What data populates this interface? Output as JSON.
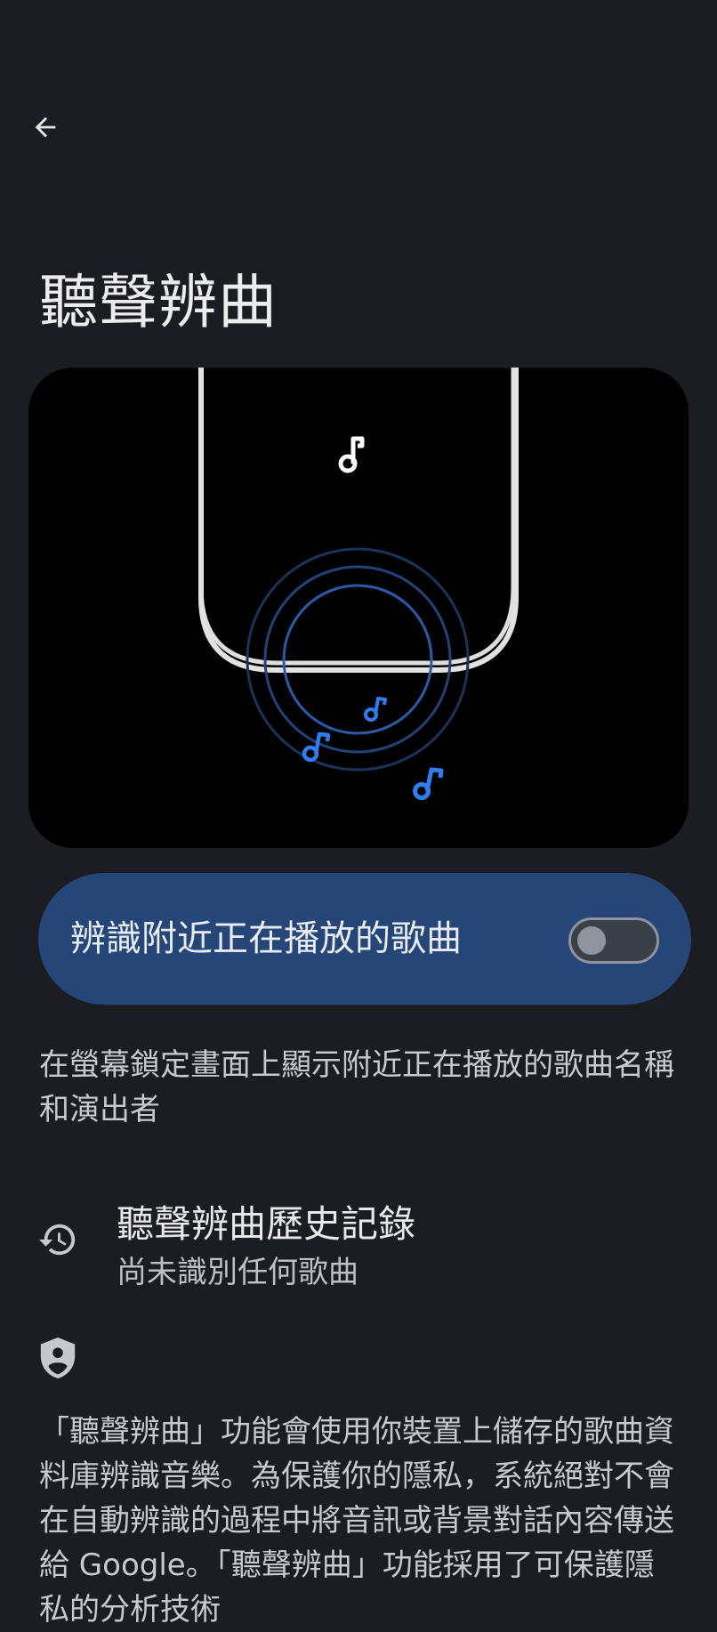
{
  "header": {
    "back_icon": "arrow-back-icon",
    "title": "聽聲辨曲"
  },
  "toggle": {
    "label": "辨識附近正在播放的歌曲",
    "state": "off"
  },
  "description": "在螢幕鎖定畫面上顯示附近正在播放的歌曲名稱和演出者",
  "history": {
    "icon": "history-icon",
    "title": "聽聲辨曲歷史記錄",
    "subtitle": "尚未識別任何歌曲"
  },
  "privacy": {
    "icon": "privacy-shield-icon",
    "text": "「聽聲辨曲」功能會使用你裝置上儲存的歌曲資料庫辨識音樂。為保護你的隱私，系統絕對不會在自動辨識的過程中將音訊或背景對話內容傳送給 Google。「聽聲辨曲」功能採用了可保護隱私的分析技術"
  },
  "colors": {
    "background": "#1b1d22",
    "card": "#264678",
    "accent": "#2f7df2"
  }
}
